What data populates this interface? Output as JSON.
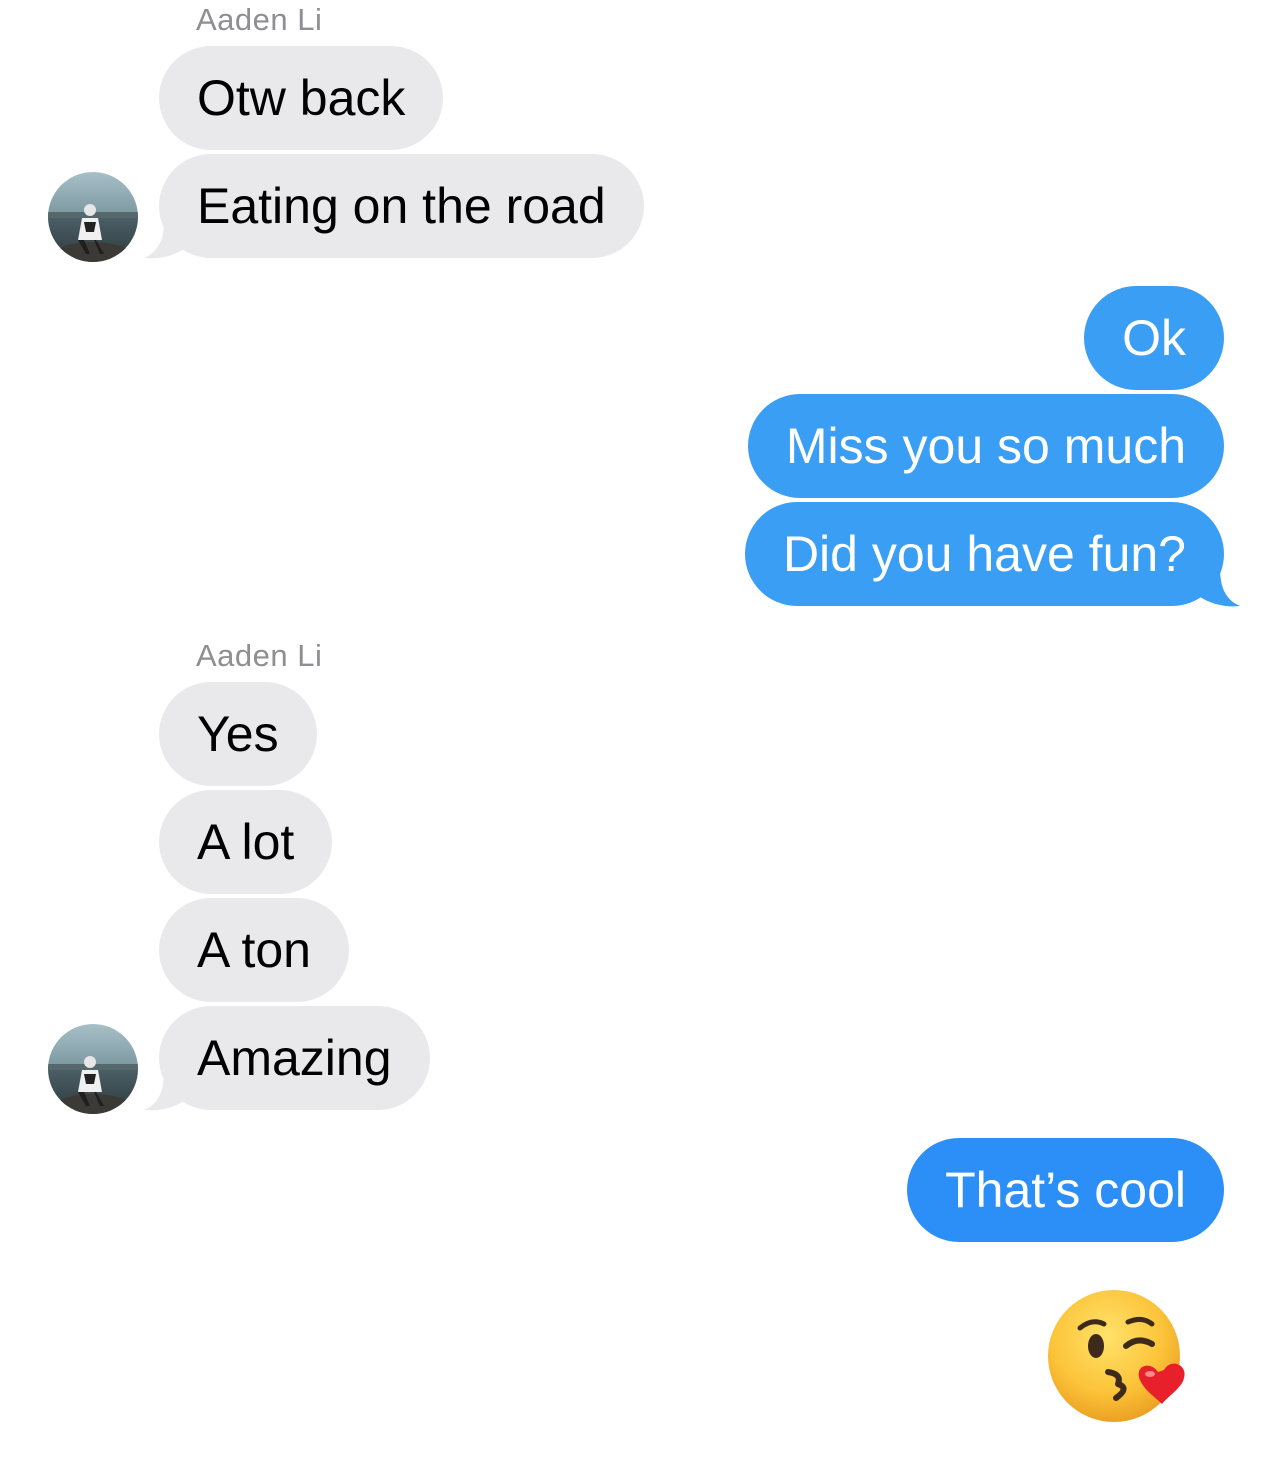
{
  "conversation": {
    "groups": [
      {
        "sender": "Aaden Li",
        "messages": [
          "Otw back",
          "Eating on the road"
        ]
      },
      {
        "sender": "me",
        "messages": [
          "Ok",
          "Miss you so much",
          "Did you have fun?"
        ]
      },
      {
        "sender": "Aaden Li",
        "messages": [
          "Yes",
          "A lot",
          "A ton",
          "Amazing"
        ]
      },
      {
        "sender": "me",
        "messages": [
          "That’s cool"
        ]
      }
    ],
    "last_emoji": "face-throwing-a-kiss-emoji"
  },
  "colors": {
    "incoming_bubble": "#e9e9eb",
    "outgoing_bubble": "#3a9ef5",
    "outgoing_bubble_dark": "#2b8ff7",
    "sender_name": "#8e8e93"
  }
}
